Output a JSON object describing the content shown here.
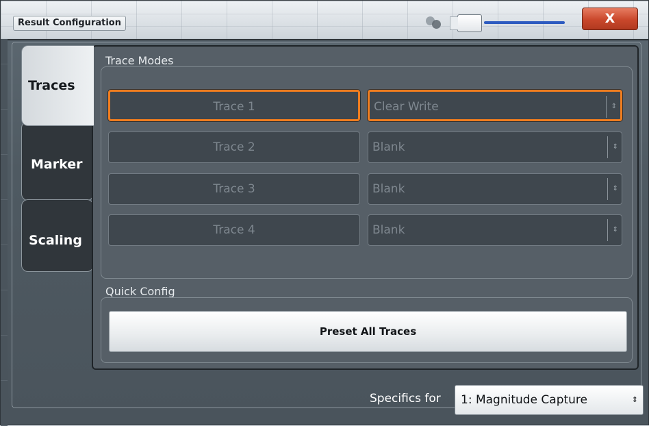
{
  "window": {
    "title": "Result Configuration",
    "close_label": "X"
  },
  "tabs": [
    {
      "label": "Traces",
      "active": true
    },
    {
      "label": "Marker",
      "active": false
    },
    {
      "label": "Scaling",
      "active": false
    }
  ],
  "trace_modes": {
    "group_label": "Trace Modes",
    "rows": [
      {
        "trace": "Trace 1",
        "mode": "Clear Write",
        "focused": true
      },
      {
        "trace": "Trace 2",
        "mode": "Blank",
        "focused": false
      },
      {
        "trace": "Trace 3",
        "mode": "Blank",
        "focused": false
      },
      {
        "trace": "Trace 4",
        "mode": "Blank",
        "focused": false
      }
    ]
  },
  "quick_config": {
    "group_label": "Quick Config",
    "preset_label": "Preset All Traces"
  },
  "specifics": {
    "label": "Specifics for",
    "selected": "1: Magnitude Capture"
  },
  "icons": {
    "transparency": "transparency-icon",
    "select_arrow": "updown-arrow-icon"
  },
  "colors": {
    "focus_accent": "#f07d1f",
    "close_button": "#c9472b",
    "slider": "#2d5bc0"
  }
}
